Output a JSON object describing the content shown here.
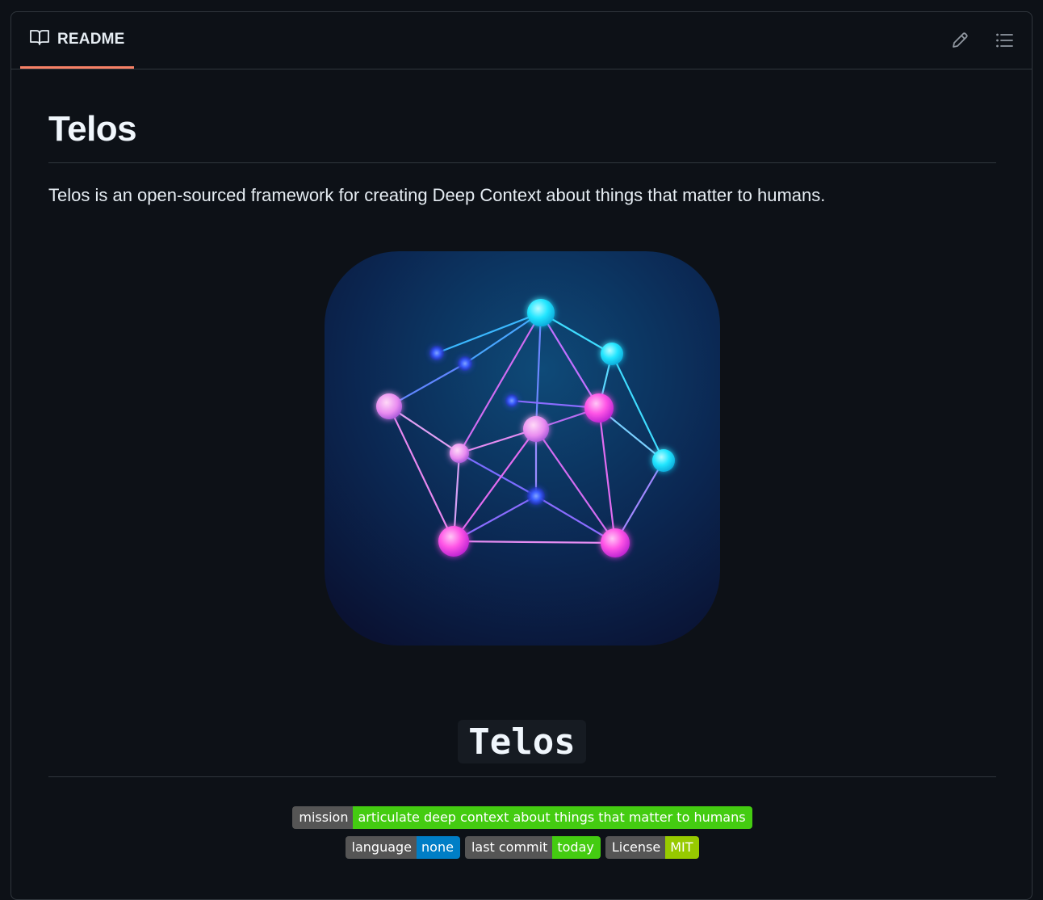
{
  "header": {
    "tab_label": "README",
    "book_icon": "book-icon",
    "edit_icon": "pencil-icon",
    "outline_icon": "list-icon"
  },
  "content": {
    "title": "Telos",
    "description": "Telos is an open-sourced framework for creating Deep Context about things that matter to humans.",
    "code_title": "Telos"
  },
  "badges": {
    "row1": [
      {
        "label": "mission",
        "value": "articulate deep context about things that matter to humans",
        "color": "#4c1"
      }
    ],
    "row2": [
      {
        "label": "language",
        "value": "none",
        "color": "#007ec6"
      },
      {
        "label": "last commit",
        "value": "today",
        "color": "#4c1"
      },
      {
        "label": "License",
        "value": "MIT",
        "color": "#97ca00"
      }
    ]
  },
  "colors": {
    "accent_underline": "#f78166",
    "node_cyan": "#22e6ff",
    "node_pink": "#ff55e6",
    "node_blue": "#3a5cff"
  }
}
